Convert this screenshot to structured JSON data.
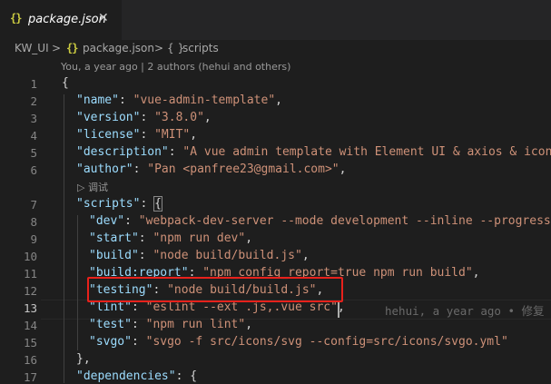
{
  "tab": {
    "icon": "{}",
    "label": "package.json",
    "close": "✕"
  },
  "breadcrumb": {
    "root": "KW_UI",
    "sep1": ">",
    "json_icon": "{}",
    "file": "package.json",
    "sep2": ">",
    "section_icon": "{ }",
    "section": "scripts"
  },
  "codelens": "You, a year ago | 2 authors (hehui and others)",
  "debug_lens": "▷ 调试",
  "blame": "hehui, a year ago • 修复",
  "line_numbers": [
    "1",
    "2",
    "3",
    "4",
    "5",
    "6",
    "7",
    "8",
    "9",
    "10",
    "11",
    "12",
    "13",
    "14",
    "15",
    "16",
    "17"
  ],
  "lines": {
    "l1": {
      "p": "{"
    },
    "l2": {
      "k": "\"name\"",
      "p": ": ",
      "v": "\"vue-admin-template\"",
      "e": ","
    },
    "l3": {
      "k": "\"version\"",
      "p": ": ",
      "v": "\"3.8.0\"",
      "e": ","
    },
    "l4": {
      "k": "\"license\"",
      "p": ": ",
      "v": "\"MIT\"",
      "e": ","
    },
    "l5": {
      "k": "\"description\"",
      "p": ": ",
      "v": "\"A vue admin template with Element UI & axios & iconfo"
    },
    "l6": {
      "k": "\"author\"",
      "p": ": ",
      "v": "\"Pan <panfree23@gmail.com>\"",
      "e": ","
    },
    "l7": {
      "k": "\"scripts\"",
      "p": ": ",
      "b": "{"
    },
    "l8": {
      "k": "\"dev\"",
      "p": ": ",
      "v": "\"webpack-dev-server --mode development --inline --progress"
    },
    "l9": {
      "k": "\"start\"",
      "p": ": ",
      "v": "\"npm run dev\"",
      "e": ","
    },
    "l10": {
      "k": "\"build\"",
      "p": ": ",
      "v": "\"node build/build.js\"",
      "e": ","
    },
    "l11": {
      "k": "\"build:report\"",
      "p": ": ",
      "v": "\"npm_config_report=true npm run build\"",
      "e": ","
    },
    "l12": {
      "k": "\"testing\"",
      "p": ": ",
      "v": "\"node build/build.js\"",
      "e": ","
    },
    "l13": {
      "k": "\"lint\"",
      "p": ": ",
      "v": "\"eslint --ext .js,.vue src\"",
      "e": ","
    },
    "l14": {
      "k": "\"test\"",
      "p": ": ",
      "v": "\"npm run lint\"",
      "e": ","
    },
    "l15": {
      "k": "\"svgo\"",
      "p": ": ",
      "v": "\"svgo -f src/icons/svg --config=src/icons/svgo.yml\""
    },
    "l16": {
      "p": "},"
    },
    "l17": {
      "k": "\"dependencies\"",
      "p": ": ",
      "b": "{"
    }
  }
}
